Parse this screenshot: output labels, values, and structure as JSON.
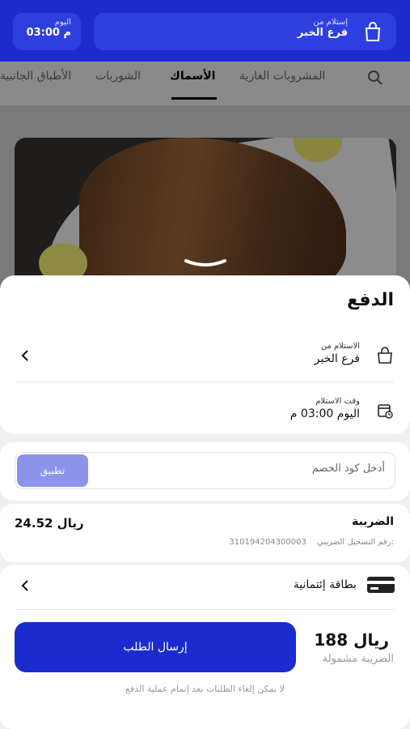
{
  "header": {
    "time": {
      "label": "اليوم",
      "value": "03:00 م"
    },
    "branch": {
      "label": "إستلام من",
      "value": "فرع الخبر"
    }
  },
  "tabs": [
    "المشروبات الغازية",
    "الأسماك",
    "الشوربات",
    "الأطباق الجانبية"
  ],
  "active_tab": "الأسماك",
  "sheet": {
    "title": "الدفع",
    "pickup": {
      "label": "الاستلام من",
      "value": "فرع الخبر"
    },
    "pickup_time": {
      "label": "وقت الاستلام",
      "value": "اليوم 03:00 م"
    },
    "coupon": {
      "placeholder": "أدخل كود الخصم",
      "apply_label": "تطبيق"
    },
    "tax": {
      "title": "الضريبة",
      "amount": "24.52 ريال",
      "reg_label": "رقم التسجيل الضريبي:",
      "reg_number": "310194204300003"
    },
    "payment_method": "بطاقة إئتمانية",
    "total": {
      "price": "188 ريال",
      "note": "الضريبة مشمولة"
    },
    "submit_label": "إرسال الطلب",
    "footer_note": "لا يمكن إلغاء الطلبات بعد إتمام عملية الدفع"
  },
  "colors": {
    "brand": "#1b2bd0",
    "apply_button": "#8b93ea"
  },
  "icons": [
    "shopping-bag-icon",
    "search-icon",
    "calendar-clock-icon",
    "chevron-left-icon",
    "credit-card-icon",
    "drag-handle-icon"
  ]
}
